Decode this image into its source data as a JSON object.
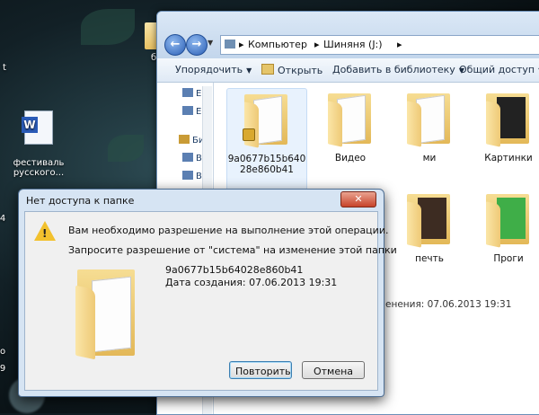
{
  "desktop": {
    "icons": [
      {
        "label": "бы"
      },
      {
        "label": "фестиваль\nрусского..."
      }
    ],
    "edge_chars": [
      "t",
      "4",
      "о",
      "9"
    ]
  },
  "explorer": {
    "address": {
      "crumbs": [
        "Компьютер",
        "Шиняня (J:)"
      ]
    },
    "toolbar": {
      "organize": "Упорядочить",
      "open": "Открыть",
      "add_to_library": "Добавить в библиотеку",
      "share": "Общий доступ"
    },
    "nav_pane": {
      "items": [
        "Е",
        "Е",
        "Би",
        "В",
        "В"
      ]
    },
    "items": [
      {
        "label": "9a0677b15b64028e860b41",
        "selected": true,
        "locked": true
      },
      {
        "label": "Видео"
      },
      {
        "label": "ми"
      },
      {
        "label": "Картинки"
      },
      {
        "label": ""
      },
      {
        "label": "печть"
      },
      {
        "label": "Проги"
      }
    ],
    "status": "енения: 07.06.2013 19:31"
  },
  "dialog": {
    "title": "Нет доступа к папке",
    "close": "✕",
    "line1": "Вам необходимо разрешение на выполнение этой операции.",
    "line2": "Запросите разрешение от \"система\" на изменение этой папки",
    "folder_name": "9a0677b15b64028e860b41",
    "created": "Дата создания: 07.06.2013 19:31",
    "retry": "Повторить",
    "cancel": "Отмена"
  },
  "colors": {
    "accent": "#3c7fb1",
    "folder": "#e3b858",
    "warning": "#f2c12e"
  }
}
